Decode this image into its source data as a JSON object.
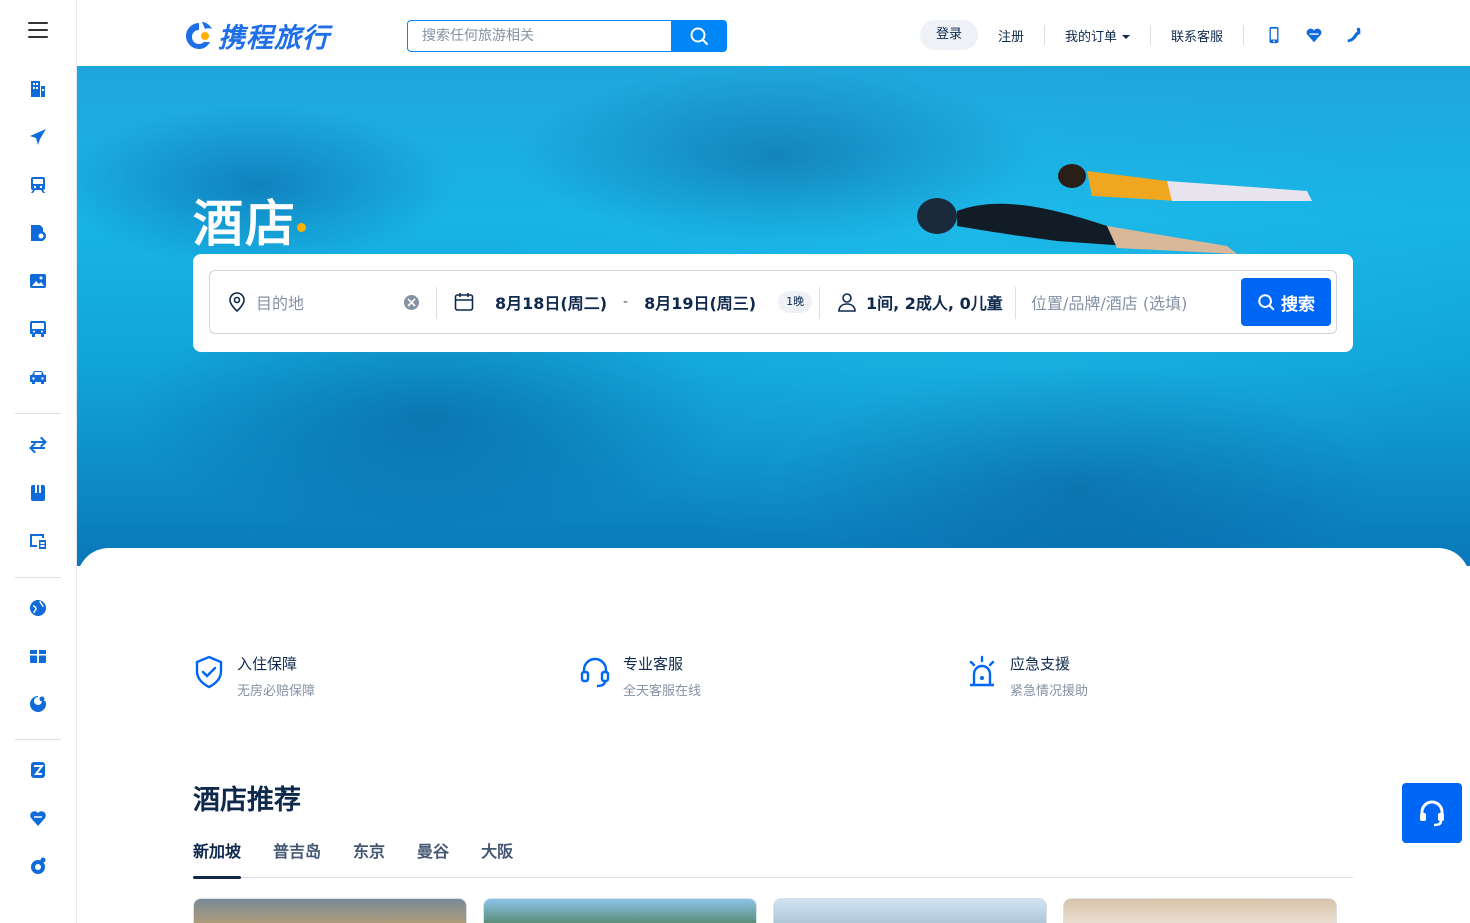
{
  "header": {
    "logo_text": "携程旅行",
    "search_placeholder": "搜索任何旅游相关",
    "nav": {
      "login": "登录",
      "register": "注册",
      "orders": "我的订单",
      "service": "联系客服"
    }
  },
  "sidebar": {
    "items": [
      {
        "icon": "hotel-icon"
      },
      {
        "icon": "flight-icon"
      },
      {
        "icon": "train-icon"
      },
      {
        "icon": "tour-icon"
      },
      {
        "icon": "attraction-icon"
      },
      {
        "icon": "bus-icon"
      },
      {
        "icon": "car-icon"
      },
      {
        "icon": "transfer-icon"
      },
      {
        "icon": "guide-icon"
      },
      {
        "icon": "ticket-icon"
      },
      {
        "icon": "global-icon"
      },
      {
        "icon": "gift-icon"
      },
      {
        "icon": "ctrip-icon"
      },
      {
        "icon": "zhixing-icon"
      },
      {
        "icon": "charity-icon"
      },
      {
        "icon": "ctrip-logo-icon"
      }
    ]
  },
  "hero": {
    "title": "酒店",
    "booking": {
      "destination_placeholder": "目的地",
      "checkin": "8月18日(周二)",
      "dash": "-",
      "checkout": "8月19日(周三)",
      "nights": "1晚",
      "guests": "1间, 2成人, 0儿童",
      "keyword_placeholder": "位置/品牌/酒店 (选填)",
      "search_label": "搜索"
    }
  },
  "features": [
    {
      "title": "入住保障",
      "sub": "无房必赔保障"
    },
    {
      "title": "专业客服",
      "sub": "全天客服在线"
    },
    {
      "title": "应急支援",
      "sub": "紧急情况援助"
    }
  ],
  "recommend": {
    "title": "酒店推荐",
    "tabs": [
      "新加坡",
      "普吉岛",
      "东京",
      "曼谷",
      "大阪"
    ]
  },
  "colors": {
    "brand": "#0066f6",
    "accent_dot": "#ffb000",
    "text_primary": "#0f294d"
  }
}
